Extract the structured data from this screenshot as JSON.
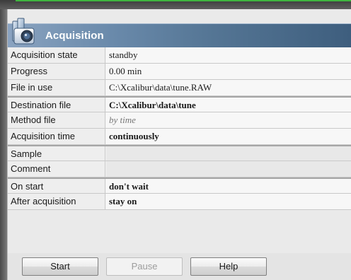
{
  "panel": {
    "title": "Acquisition"
  },
  "rows": [
    {
      "label": "Acquisition state",
      "value": "standby"
    },
    {
      "label": "Progress",
      "value": "0.00 min"
    },
    {
      "label": "File in use",
      "value": "C:\\Xcalibur\\data\\tune.RAW"
    },
    {
      "label": "Destination file",
      "value": "C:\\Xcalibur\\data\\tune"
    },
    {
      "label": "Method file",
      "value": "by time"
    },
    {
      "label": "Acquisition time",
      "value": "continuously"
    },
    {
      "label": "Sample",
      "value": ""
    },
    {
      "label": "Comment",
      "value": ""
    },
    {
      "label": "On start",
      "value": "don't wait"
    },
    {
      "label": "After acquisition",
      "value": "stay on"
    }
  ],
  "buttons": {
    "start": "Start",
    "pause": "Pause",
    "help": "Help"
  },
  "icons": {
    "header": "acquisition-camera-icon"
  },
  "colors": {
    "header_gradient_start": "#8aa3c0",
    "header_gradient_end": "#3e5e7e",
    "accent_green": "#3fb53f"
  }
}
